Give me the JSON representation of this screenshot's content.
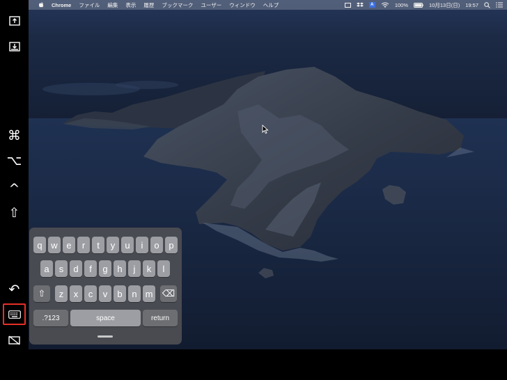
{
  "menubar": {
    "app_name": "Chrome",
    "menus": [
      "ファイル",
      "編集",
      "表示",
      "履歴",
      "ブックマーク",
      "ユーザー",
      "ウィンドウ",
      "ヘルプ"
    ],
    "battery": "100%",
    "date_time": "10月13日(日)",
    "time": "19:57"
  },
  "sidebar": {
    "icons": [
      "tray-up-icon",
      "tray-down-icon",
      "command-icon",
      "option-icon",
      "control-icon",
      "shift-icon",
      "undo-icon",
      "keyboard-icon",
      "hide-screen-icon"
    ],
    "glyphs": {
      "command": "⌘",
      "option": "⌥",
      "control": "^",
      "shift": "⇧",
      "undo": "↶"
    },
    "active": "keyboard-icon",
    "active_color": "#e53127"
  },
  "keyboard": {
    "row1": [
      "q",
      "w",
      "e",
      "r",
      "t",
      "y",
      "u",
      "i",
      "o",
      "p"
    ],
    "row2": [
      "a",
      "s",
      "d",
      "f",
      "g",
      "h",
      "j",
      "k",
      "l"
    ],
    "row3": [
      "z",
      "x",
      "c",
      "v",
      "b",
      "n",
      "m"
    ],
    "shift_glyph": "⇧",
    "delete_glyph": "⌫",
    "numbers_label": ".?123",
    "space_label": "space",
    "return_label": "return"
  },
  "colors": {
    "key": "#9c9ea3",
    "key_dark": "#6c6e72",
    "keyboard_bg": "#4e4f54",
    "sky": "#1c2a45",
    "sea": "#182740"
  }
}
